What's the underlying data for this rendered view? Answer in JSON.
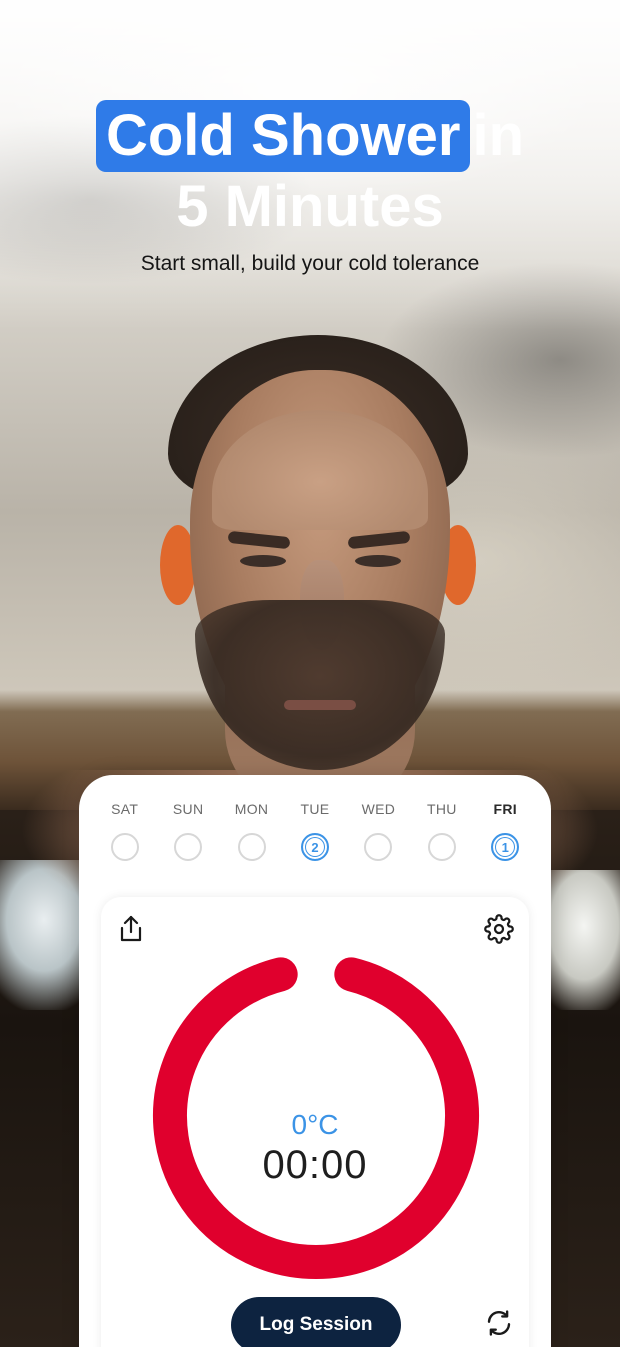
{
  "hero": {
    "title_highlight": "Cold Shower",
    "title_rest": "in",
    "title_line2": "5 Minutes",
    "subtitle": "Start small, build your cold tolerance"
  },
  "week": [
    {
      "label": "SAT",
      "count": "",
      "active": false,
      "bold": false
    },
    {
      "label": "SUN",
      "count": "",
      "active": false,
      "bold": false
    },
    {
      "label": "MON",
      "count": "",
      "active": false,
      "bold": false
    },
    {
      "label": "TUE",
      "count": "2",
      "active": true,
      "bold": false
    },
    {
      "label": "WED",
      "count": "",
      "active": false,
      "bold": false
    },
    {
      "label": "THU",
      "count": "",
      "active": false,
      "bold": false
    },
    {
      "label": "FRI",
      "count": "1",
      "active": true,
      "bold": true
    }
  ],
  "timer": {
    "temperature": "0°C",
    "time": "00:00",
    "ring_color": "#e0002d"
  },
  "actions": {
    "log_label": "Log Session",
    "share_icon": "share-icon",
    "settings_icon": "gear-icon",
    "refresh_icon": "refresh-icon"
  },
  "colors": {
    "accent_blue": "#2f7be8",
    "day_blue": "#3b93e6",
    "button_navy": "#0d2340"
  }
}
